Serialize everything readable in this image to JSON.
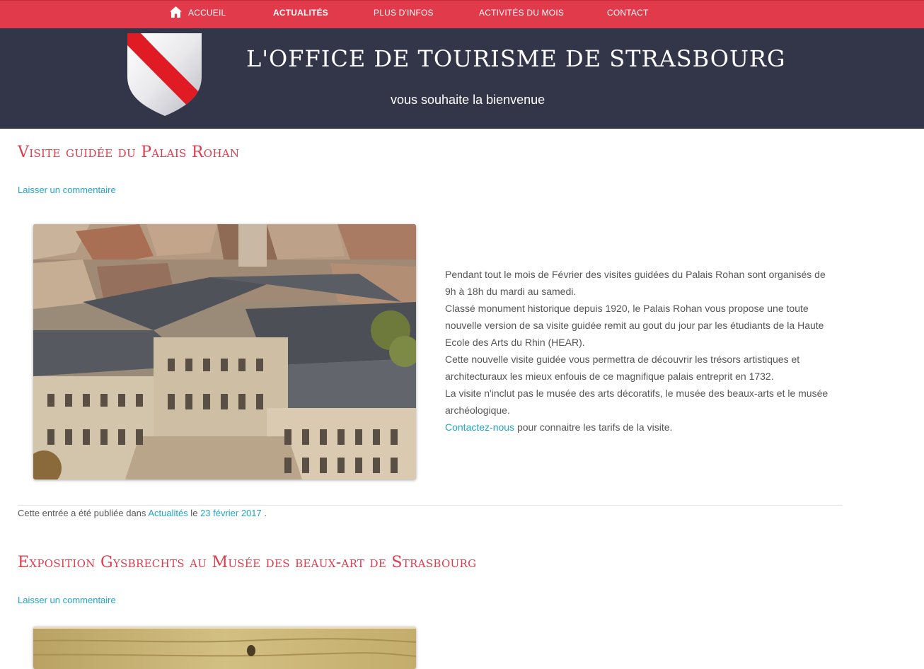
{
  "nav": {
    "home_icon": "home-icon",
    "items": [
      {
        "label": "Accueil"
      },
      {
        "label": "Actualités"
      },
      {
        "label": "Plus d'infos"
      },
      {
        "label": "Activités du mois"
      },
      {
        "label": "Contact"
      }
    ]
  },
  "header": {
    "title": "L'OFFICE DE TOURISME DE STRASBOURG",
    "subtitle": "vous souhaite la bienvenue",
    "logo": "strasbourg-coat-of-arms",
    "colors": {
      "nav_bg": "#e13a4b",
      "header_bg": "#333549",
      "accent": "#e13a4b",
      "link": "#20a5c8"
    }
  },
  "posts": [
    {
      "title": "Visite guidée du Palais Rohan",
      "comment_link": "Laisser un commentaire",
      "paragraphs": [
        "Pendant tout le mois de Février des visites guidées du Palais Rohan sont organisés de 9h à 18h du mardi au samedi.",
        "Classé monument historique depuis 1920, le Palais Rohan vous propose une toute nouvelle version de sa visite guidée remit au gout du jour par les étudiants de la Haute Ecole des Arts du Rhin (HEAR).",
        "Cette nouvelle visite guidée vous permettra de découvrir les trésors artistiques et architecturaux les mieux enfouis de ce magnifique palais entreprit en 1732.",
        "La visite n'inclut pas le musée des arts décoratifs, le musée des beaux-arts et le musée archéologique."
      ],
      "contact_link": "Contactez-nous",
      "contact_rest": " pour connaitre les tarifs de la visite.",
      "meta": {
        "prefix": "Cette entrée a été publiée dans ",
        "category": "Actualités",
        "middle": " le ",
        "date": "23 février 2017",
        "suffix": " ."
      }
    },
    {
      "title": "Exposition Gysbrechts au Musée des beaux-art de Strasbourg",
      "comment_link": "Laisser un commentaire"
    }
  ]
}
